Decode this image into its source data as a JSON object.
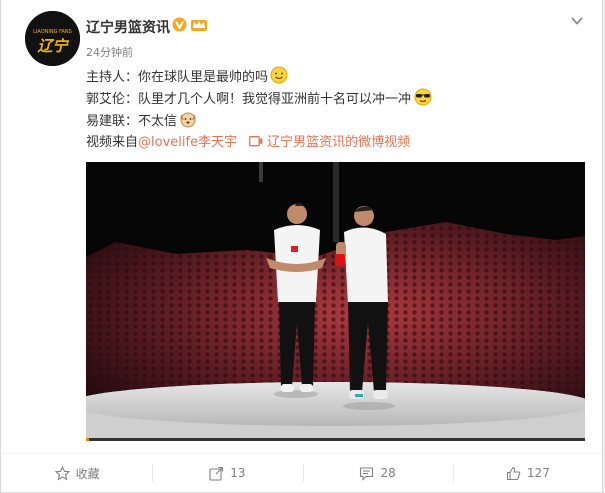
{
  "post": {
    "author": "辽宁男篮资讯",
    "avatar_text": "辽宁",
    "avatar_small_text": "LIAONING FANS",
    "time": "24分钟前",
    "lines": [
      {
        "text": "主持人：你在球队里是最帅的吗",
        "emoji": "smile-emoji"
      },
      {
        "text": "郭艾伦：队里才几个人啊！我觉得亚洲前十名可以冲一冲",
        "emoji": "sunglasses-emoji"
      },
      {
        "text": "易建联：不太信",
        "emoji": "dog-emoji"
      }
    ],
    "source": {
      "prefix": "视频来自",
      "user_link": "@lovelife李天宇",
      "video_link": "辽宁男篮资讯的微博视频"
    }
  },
  "video": {
    "progress": 0.006,
    "colors": {
      "progress": "#ff8200",
      "background": "#060606"
    }
  },
  "actions": {
    "favorite": "收藏",
    "repost": "13",
    "comment": "28",
    "like": "127"
  },
  "colors": {
    "link": "#eb7350",
    "vip": "#f5a623",
    "name": "#333333",
    "meta": "#808080"
  }
}
